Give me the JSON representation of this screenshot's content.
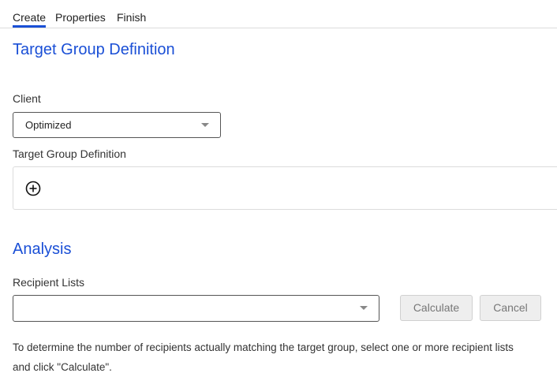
{
  "tabs": {
    "create": "Create",
    "properties": "Properties",
    "finish": "Finish",
    "active": "Create"
  },
  "definition_section": {
    "title": "Target Group Definition",
    "client_label": "Client",
    "client_value": "Optimized",
    "definition_label": "Target Group Definition",
    "add_icon": "plus-circle-icon"
  },
  "analysis_section": {
    "title": "Analysis",
    "recipient_lists_label": "Recipient Lists",
    "recipient_lists_value": "",
    "calculate_label": "Calculate",
    "cancel_label": "Cancel",
    "help_text": "To determine the number of recipients actually matching the target group, select one or more recipient lists and click \"Calculate\"."
  },
  "colors": {
    "accent": "#1a4fd6",
    "text": "#333333",
    "border": "#dcdcdc",
    "disabled_button_bg": "#eeeeee",
    "disabled_button_text": "#777777"
  }
}
